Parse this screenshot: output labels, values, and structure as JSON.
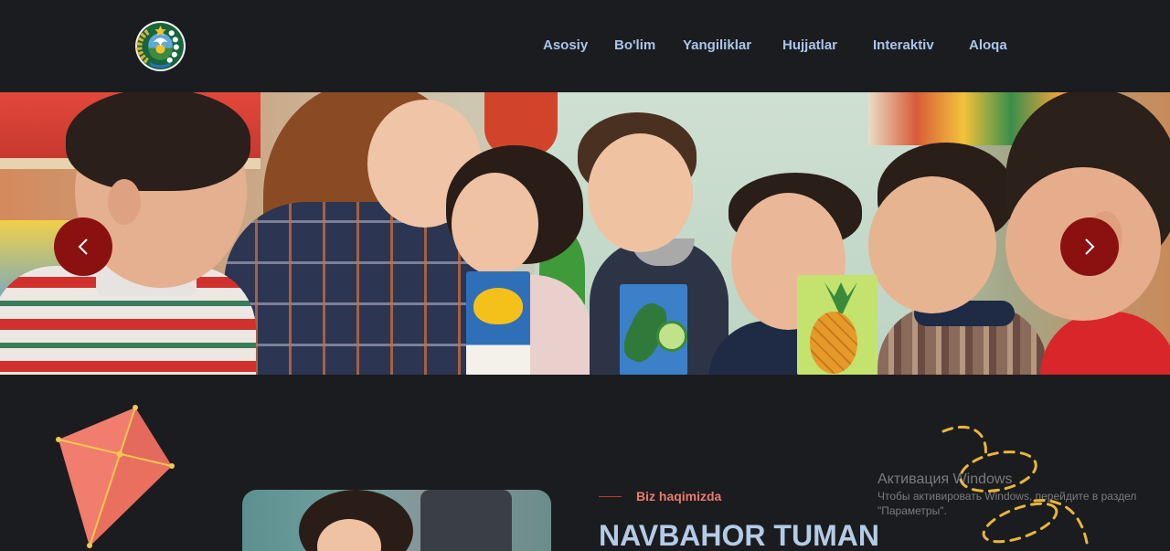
{
  "header": {
    "logo": {
      "icon": "state-emblem-icon"
    },
    "nav": [
      {
        "label": "Asosiy"
      },
      {
        "label": "Bo'lim"
      },
      {
        "label": "Yangiliklar"
      },
      {
        "label": "Hujjatlar"
      },
      {
        "label": "Interaktiv"
      },
      {
        "label": "Aloqa"
      }
    ]
  },
  "hero": {
    "image": "photo-teacher-with-children",
    "prev_icon": "chevron-left-icon",
    "next_icon": "chevron-right-icon"
  },
  "about": {
    "decoration_icons": [
      "kite-icon",
      "dashed-swirl-decoration"
    ],
    "image": "photo-girl",
    "eyebrow": "Biz haqimizda",
    "heading": "NAVBAHOR TUMAN"
  },
  "system_watermark": {
    "title": "Активация Windows",
    "line1": "Чтобы активировать Windows, перейдите в раздел",
    "line2": "\"Параметры\"."
  },
  "colors": {
    "background": "#1b1c1f",
    "nav_text": "#a9c5ea",
    "carousel_button": "#8b1111",
    "eyebrow": "#ec7b6e",
    "heading": "#b4cbe6",
    "kite": "#f07d6e",
    "decoration_dash": "#e9b63b"
  }
}
